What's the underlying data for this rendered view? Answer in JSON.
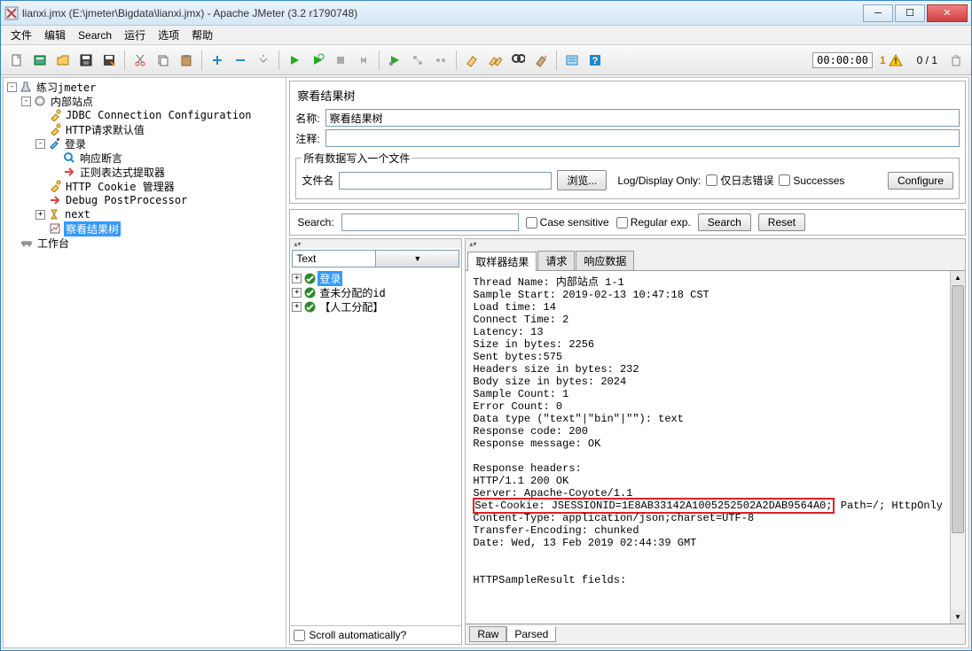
{
  "title": "lianxi.jmx (E:\\jmeter\\Bigdata\\lianxi.jmx) - Apache JMeter (3.2 r1790748)",
  "menu": {
    "file": "文件",
    "edit": "编辑",
    "search": "Search",
    "run": "运行",
    "options": "选项",
    "help": "帮助"
  },
  "toolbar": {
    "timer": "00:00:00",
    "warn_count": "1",
    "thread_count": "0 / 1"
  },
  "tree": {
    "n0": "练习jmeter",
    "n1": "内部站点",
    "n2": "JDBC Connection Configuration",
    "n3": "HTTP请求默认值",
    "n4": "登录",
    "n5": "响应断言",
    "n6": "正则表达式提取器",
    "n7": "HTTP Cookie 管理器",
    "n8": "Debug PostProcessor",
    "n9": "next",
    "n10": "察看结果树",
    "n11": "工作台"
  },
  "panel": {
    "title": "察看结果树",
    "name_label": "名称:",
    "name_value": "察看结果树",
    "comment_label": "注释:",
    "comment_value": "",
    "file_section_title": "所有数据写入一个文件",
    "filename_label": "文件名",
    "filename_value": "",
    "browse": "浏览...",
    "logdisplay": "Log/Display Only:",
    "errors_only": "仅日志错误",
    "successes": "Successes",
    "configure": "Configure"
  },
  "search": {
    "label": "Search:",
    "value": "",
    "case": "Case sensitive",
    "regex": "Regular exp.",
    "btn": "Search",
    "reset": "Reset"
  },
  "renderer": "Text",
  "result_items": {
    "r0": "登录",
    "r1": "查未分配的id",
    "r2": "【人工分配】"
  },
  "scroll_auto": "Scroll automatically?",
  "tabs": {
    "sampler": "取样器结果",
    "request": "请求",
    "response": "响应数据"
  },
  "detail": {
    "line0": "Thread Name: 内部站点 1-1",
    "line1": "Sample Start: 2019-02-13 10:47:18 CST",
    "line2": "Load time: 14",
    "line3": "Connect Time: 2",
    "line4": "Latency: 13",
    "line5": "Size in bytes: 2256",
    "line6": "Sent bytes:575",
    "line7": "Headers size in bytes: 232",
    "line8": "Body size in bytes: 2024",
    "line9": "Sample Count: 1",
    "line10": "Error Count: 0",
    "line11": "Data type (\"text\"|\"bin\"|\"\"): text",
    "line12": "Response code: 200",
    "line13": "Response message: OK",
    "line14": "",
    "line15": "Response headers:",
    "line16": "HTTP/1.1 200 OK",
    "line17": "Server: Apache-Coyote/1.1",
    "hl": "Set-Cookie: JSESSIONID=1E8AB33142A1005252502A2DAB9564A0;",
    "hl_tail": " Path=/; HttpOnly",
    "line19": "Content-Type: application/json;charset=UTF-8",
    "line20": "Transfer-Encoding: chunked",
    "line21": "Date: Wed, 13 Feb 2019 02:44:39 GMT",
    "line22": "",
    "line23": "",
    "line24": "HTTPSampleResult fields:"
  },
  "btabs": {
    "raw": "Raw",
    "parsed": "Parsed"
  }
}
